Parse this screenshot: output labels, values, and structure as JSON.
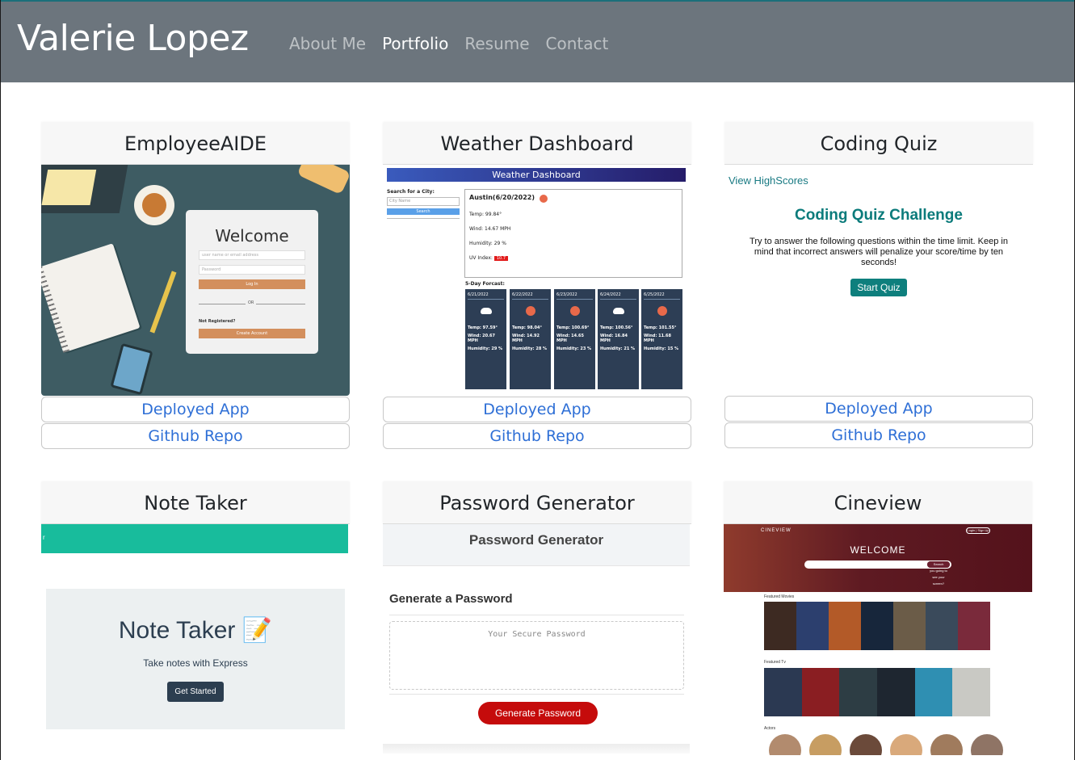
{
  "header": {
    "brand": "Valerie Lopez",
    "nav": [
      "About Me",
      "Portfolio",
      "Resume",
      "Contact"
    ],
    "active": "Portfolio"
  },
  "projects": [
    {
      "title": "EmployeeAIDE",
      "deployed_label": "Deployed App",
      "repo_label": "Github Repo",
      "preview": {
        "welcome": "Welcome",
        "username_placeholder": "user name or email address",
        "password_placeholder": "Password",
        "login": "Log In",
        "or": "OR",
        "not_registered": "Not Registered?",
        "create_account": "Create Account"
      }
    },
    {
      "title": "Weather Dashboard",
      "deployed_label": "Deployed App",
      "repo_label": "Github Repo",
      "preview": {
        "banner": "Weather Dashboard",
        "search_label": "Search for a City:",
        "search_placeholder": "City Name",
        "search_button": "Search",
        "city_date": "Austin(6/20/2022)",
        "temp": "Temp: 99.84°",
        "wind": "Wind: 14.67 MPH",
        "humidity": "Humidity: 29 %",
        "uv_label": "UV Index:",
        "uv_value": "10.7",
        "forecast_title": "5-Day Forcast:",
        "forecast": [
          {
            "date": "6/21/2022",
            "icon": "cloud",
            "temp": "Temp: 97.59°",
            "wind": "Wind: 20.67 MPH",
            "humidity": "Humidity: 29 %"
          },
          {
            "date": "6/22/2022",
            "icon": "sun",
            "temp": "Temp: 98.04°",
            "wind": "Wind: 14.92 MPH",
            "humidity": "Humidity: 28 %"
          },
          {
            "date": "6/23/2022",
            "icon": "sun",
            "temp": "Temp: 100.69°",
            "wind": "Wind: 14.65 MPH",
            "humidity": "Humidity: 23 %"
          },
          {
            "date": "6/24/2022",
            "icon": "cloud",
            "temp": "Temp: 100.56°",
            "wind": "Wind: 16.84 MPH",
            "humidity": "Humidity: 21 %"
          },
          {
            "date": "6/25/2022",
            "icon": "sun",
            "temp": "Temp: 101.55°",
            "wind": "Wind: 11.68 MPH",
            "humidity": "Humidity: 15 %"
          }
        ]
      }
    },
    {
      "title": "Coding Quiz",
      "deployed_label": "Deployed App",
      "repo_label": "Github Repo",
      "preview": {
        "highscores": "View HighScores",
        "heading": "Coding Quiz Challenge",
        "description": "Try to answer the following questions within the time limit. Keep in mind that incorrect answers will penalize your score/time by ten seconds!",
        "start": "Start Quiz"
      }
    },
    {
      "title": "Note Taker",
      "preview": {
        "navbar_text": "r",
        "heading": "Note Taker 📝",
        "subheading": "Take notes with Express",
        "button": "Get Started"
      }
    },
    {
      "title": "Password Generator",
      "preview": {
        "header": "Password Generator",
        "subheader": "Generate a Password",
        "placeholder": "Your Secure Password",
        "button": "Generate Password"
      }
    },
    {
      "title": "Cineview",
      "preview": {
        "logo": "CINEVIEW",
        "login": "Login | Sign Up",
        "welcome": "WELCOME",
        "search_placeholder": "What film are you going to see your screen?",
        "search_button": "Search",
        "featured_movies": "Featured Movies",
        "featured_tv": "Featured Tv",
        "actors": "Actors"
      }
    }
  ],
  "colors": {
    "navbar": "#6c757d",
    "link": "#2e6fd6",
    "teal": "#0b7b7b",
    "red_button": "#c50b0b"
  }
}
